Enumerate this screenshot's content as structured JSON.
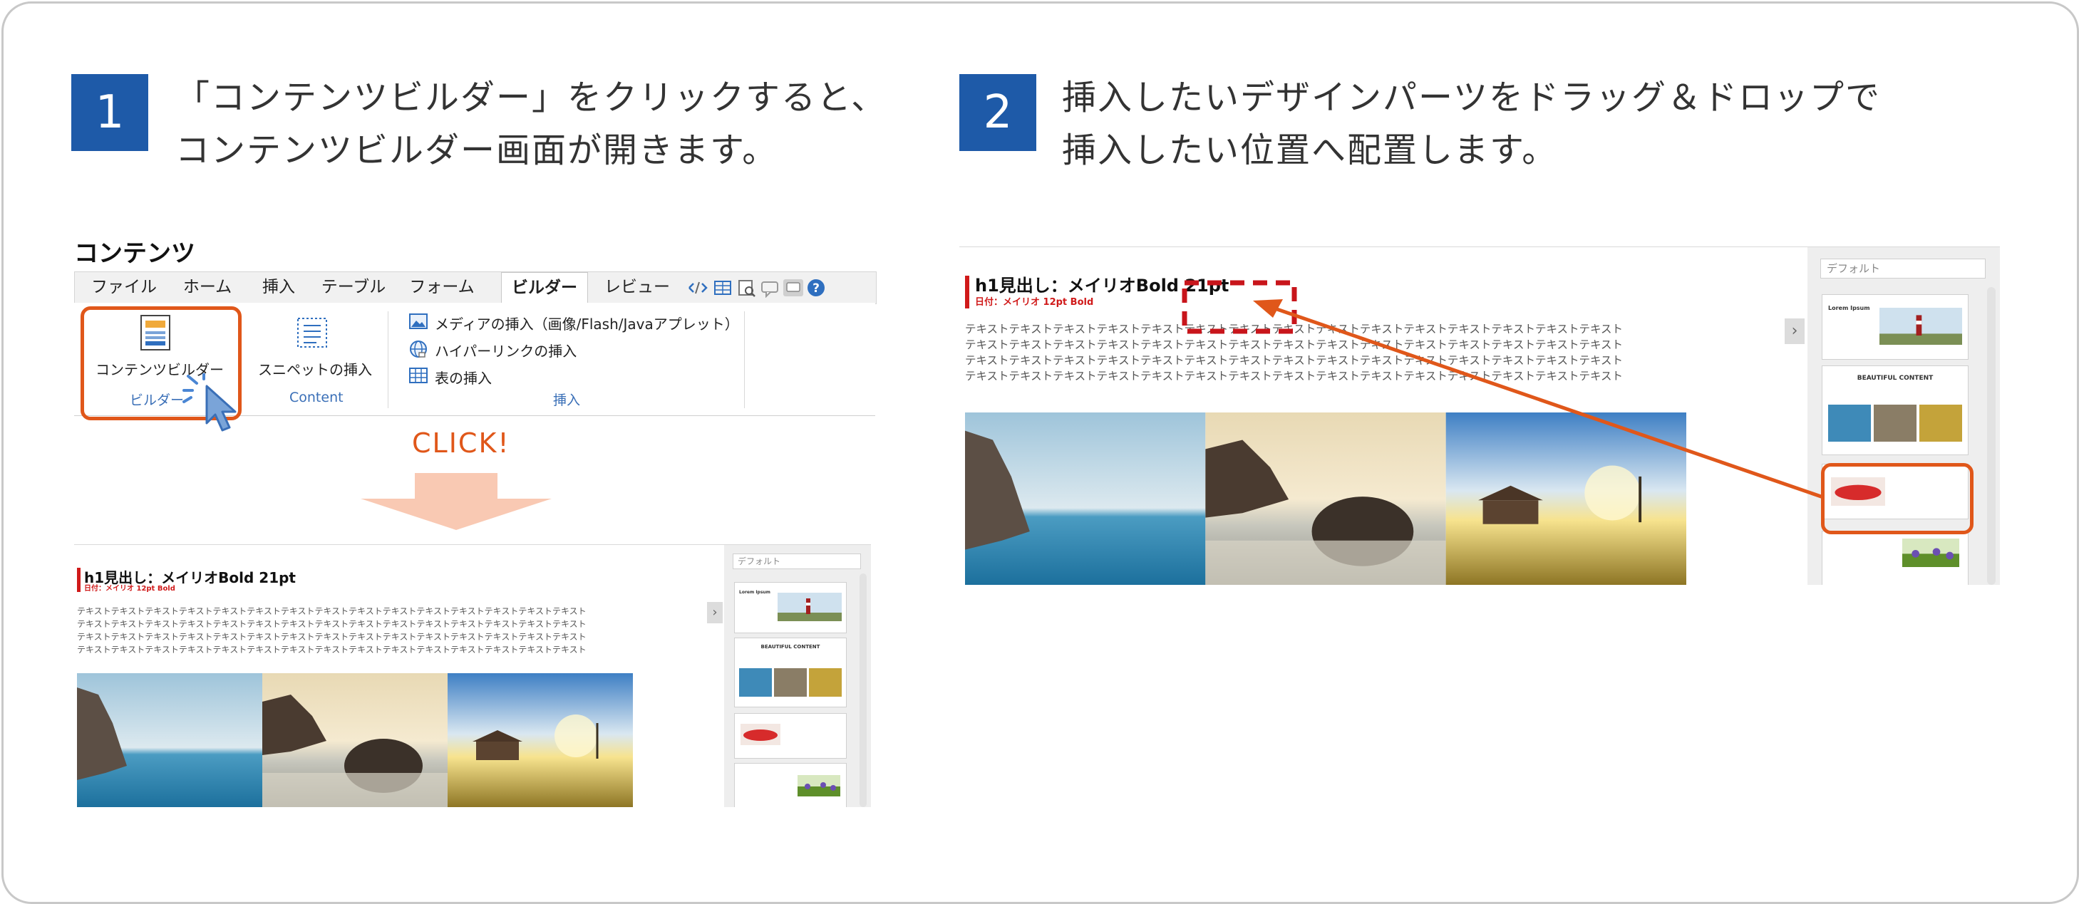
{
  "steps": [
    {
      "number": "1",
      "line1": "「コンテンツビルダー」をクリックすると、",
      "line2": "コンテンツビルダー画面が開きます。"
    },
    {
      "number": "2",
      "line1": "挿入したいデザインパーツをドラッグ＆ドロップで",
      "line2": "挿入したい位置へ配置します。"
    }
  ],
  "ribbon": {
    "section_title": "コンテンツ",
    "tabs": [
      "ファイル",
      "ホーム",
      "挿入",
      "テーブル",
      "フォーム",
      "ビルダー",
      "レビュー"
    ],
    "active_tab": "ビルダー",
    "content_builder_label": "コンテンツビルダー",
    "builder_group_label": "ビルダー",
    "snippet_label": "スニペットの挿入",
    "content_group_label": "Content",
    "media_insert_label": "メディアの挿入（画像/Flash/Javaアプレット）",
    "hyperlink_label": "ハイパーリンクの挿入",
    "table_insert_label": "表の挿入",
    "insert_group_label": "挿入"
  },
  "click_label": "CLICK!",
  "editor": {
    "heading": "h1見出し：メイリオBold 21pt",
    "date_line": "日付：メイリオ 12pt Bold",
    "body_line": "テキストテキストテキストテキストテキストテキストテキストテキストテキストテキストテキストテキストテキストテキストテキスト",
    "search_placeholder": "デフォルト",
    "expand_arrow": "›",
    "thumb_heading": "BEAUTIFUL CONTENT",
    "thumb_small_title": "Lorem Ipsum"
  },
  "colors": {
    "step_badge": "#1e5aa8",
    "highlight_orange": "#e0571a",
    "drop_target_red": "#c8151b",
    "down_arrow": "#f9c9b3",
    "heading_bar": "#d01a1a"
  }
}
